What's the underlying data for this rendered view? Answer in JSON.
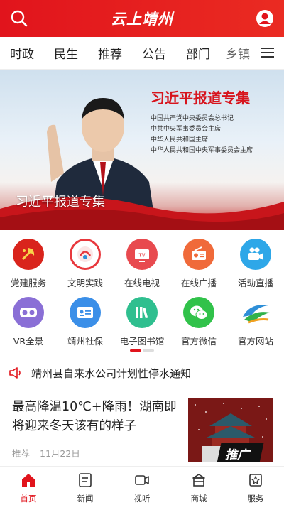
{
  "header": {
    "title": "云上靖州"
  },
  "tabs": [
    "时政",
    "民生",
    "推荐",
    "公告",
    "部门",
    "乡镇"
  ],
  "banner": {
    "title": "习近平报道专集",
    "lines": [
      "中国共产党中央委员会总书记",
      "中共中央军事委员会主席",
      "中华人民共和国主席",
      "中华人民共和国中央军事委员会主席"
    ],
    "caption": "习近平报道专集"
  },
  "grid": [
    {
      "label": "党建服务",
      "icon": "party-emblem-icon",
      "color": "#d9241c"
    },
    {
      "label": "文明实践",
      "icon": "civilization-logo-icon",
      "color": "#e8383d"
    },
    {
      "label": "在线电视",
      "icon": "tv-icon",
      "color": "#e84a4f"
    },
    {
      "label": "在线广播",
      "icon": "radio-icon",
      "color": "#f06a3a"
    },
    {
      "label": "活动直播",
      "icon": "live-camera-icon",
      "color": "#2ea7e8"
    },
    {
      "label": "VR全景",
      "icon": "vr-glasses-icon",
      "color": "#8a6fd6"
    },
    {
      "label": "靖州社保",
      "icon": "id-card-icon",
      "color": "#3b8fe8"
    },
    {
      "label": "电子图书馆",
      "icon": "books-icon",
      "color": "#2fbf8f"
    },
    {
      "label": "官方微信",
      "icon": "wechat-icon",
      "color": "#31c24a"
    },
    {
      "label": "官方网站",
      "icon": "website-logo-icon",
      "color": "#2e8fd8"
    }
  ],
  "notice": {
    "text": "靖州县自来水公司计划性停水通知"
  },
  "news": {
    "title": "最高降温10℃+降雨！湖南即将迎来冬天该有的样子",
    "tag": "推荐",
    "date": "11月22日",
    "thumb_badge": "推广"
  },
  "bottom_nav": [
    {
      "label": "首页",
      "icon": "home-icon",
      "active": true
    },
    {
      "label": "新闻",
      "icon": "news-icon",
      "active": false
    },
    {
      "label": "视听",
      "icon": "video-icon",
      "active": false
    },
    {
      "label": "商城",
      "icon": "shop-icon",
      "active": false
    },
    {
      "label": "服务",
      "icon": "service-icon",
      "active": false
    }
  ],
  "colors": {
    "primary": "#e1141c",
    "text": "#222222",
    "muted": "#999999"
  }
}
